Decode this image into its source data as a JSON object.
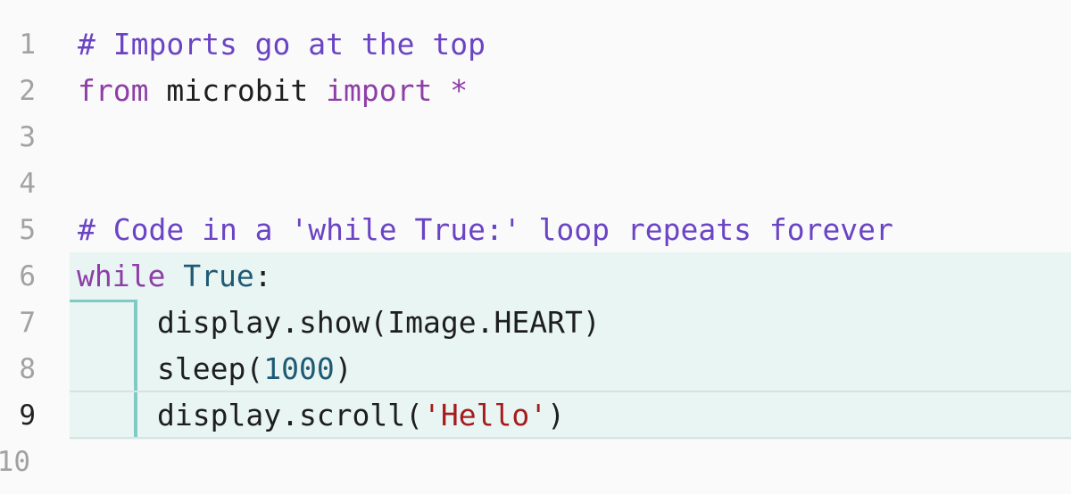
{
  "editor": {
    "line_numbers": [
      "1",
      "2",
      "3",
      "4",
      "5",
      "6",
      "7",
      "8",
      "9",
      "10"
    ],
    "active_line": "9",
    "lines": {
      "l1": {
        "comment": "# Imports go at the top"
      },
      "l2": {
        "kw_from": "from",
        "module": " microbit ",
        "kw_import": "import",
        "star": " *"
      },
      "l5": {
        "comment": "# Code in a 'while True:' loop repeats forever"
      },
      "l6": {
        "kw_while": "while",
        "sp": " ",
        "true": "True",
        "colon": ":"
      },
      "l7": {
        "text": "display.show(Image.HEART)"
      },
      "l8": {
        "fn": "sleep(",
        "num": "1000",
        "close": ")"
      },
      "l9": {
        "fn": "display.scroll(",
        "str": "'Hello'",
        "close": ")"
      }
    }
  },
  "colors": {
    "comment": "#6a44c4",
    "keyword": "#8e3ea7",
    "builtin": "#1f5a75",
    "string": "#a51c1c",
    "block_highlight": "#e8f5f3",
    "block_bar": "#7fcbc3"
  }
}
